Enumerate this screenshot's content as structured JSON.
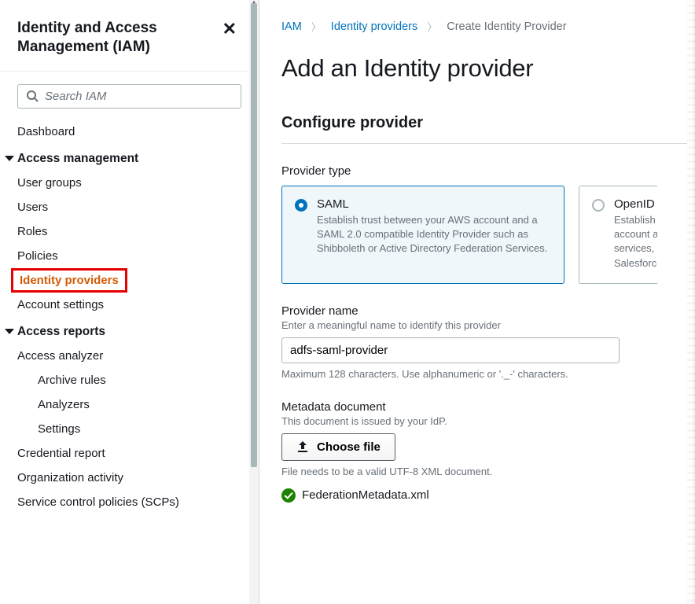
{
  "sidebar": {
    "title": "Identity and Access Management (IAM)",
    "search_placeholder": "Search IAM",
    "items": {
      "dashboard": "Dashboard",
      "section_access_mgmt": "Access management",
      "user_groups": "User groups",
      "users": "Users",
      "roles": "Roles",
      "policies": "Policies",
      "identity_providers": "Identity providers",
      "account_settings": "Account settings",
      "section_access_reports": "Access reports",
      "access_analyzer": "Access analyzer",
      "archive_rules": "Archive rules",
      "analyzers": "Analyzers",
      "settings": "Settings",
      "credential_report": "Credential report",
      "org_activity": "Organization activity",
      "scps": "Service control policies (SCPs)"
    }
  },
  "breadcrumb": {
    "root": "IAM",
    "mid": "Identity providers",
    "leaf": "Create Identity Provider"
  },
  "page": {
    "title": "Add an Identity provider",
    "section": "Configure provider"
  },
  "provider_type": {
    "label": "Provider type",
    "saml_title": "SAML",
    "saml_desc": "Establish trust between your AWS account and a SAML 2.0 compatible Identity Provider such as Shibboleth or Active Directory Federation Services.",
    "openid_title": "OpenID",
    "openid_desc": "Establish trust between your AWS account and Identity Provider services, such as Google or Salesforce."
  },
  "provider_name": {
    "label": "Provider name",
    "hint": "Enter a meaningful name to identify this provider",
    "value": "adfs-saml-provider",
    "footnote": "Maximum 128 characters. Use alphanumeric or '._-' characters."
  },
  "metadata": {
    "label": "Metadata document",
    "hint": "This document is issued by your IdP.",
    "button": "Choose file",
    "footnote": "File needs to be a valid UTF-8 XML document.",
    "filename": "FederationMetadata.xml"
  }
}
